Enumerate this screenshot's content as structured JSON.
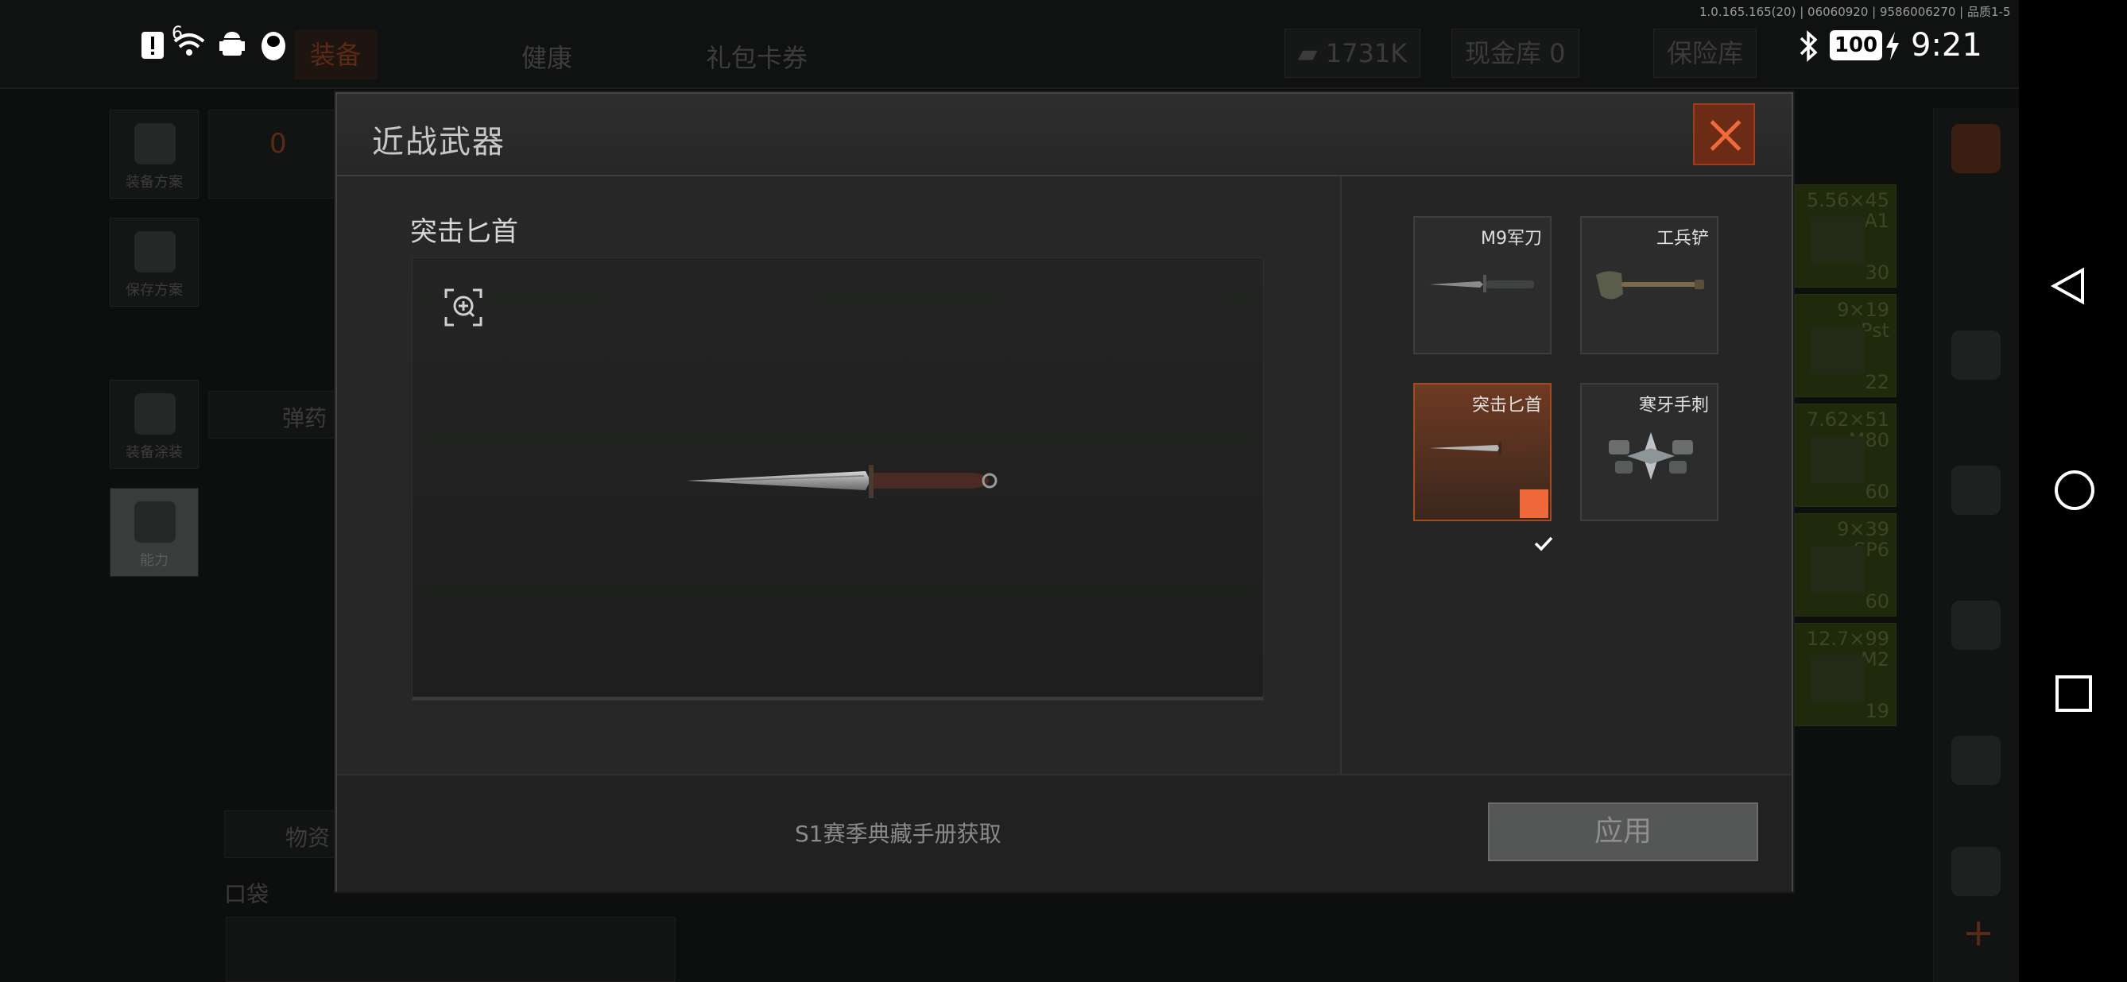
{
  "status_bar": {
    "time": "9:21",
    "battery": "100",
    "signal_sup": "6"
  },
  "build_info": "1.0.165.165(20) | 06060920 | 9586006270 | 品质1-5",
  "background": {
    "tabs": [
      {
        "label": "装备",
        "active": true
      },
      {
        "label": "健康",
        "active": false
      },
      {
        "label": "礼包卡券",
        "active": false
      }
    ],
    "currency": {
      "money": "1731K",
      "cash_vault": "现金库 0",
      "safe": "保险库"
    },
    "left_buttons": [
      "装备方案",
      "保存方案",
      "装备涂装",
      "能力"
    ],
    "backpack_count": "0",
    "panels": {
      "ammo": "弹药",
      "supplies": "物资",
      "pocket": "口袋"
    },
    "ammo": [
      {
        "caliber": "5.56×45",
        "type": "A1",
        "count": "30"
      },
      {
        "caliber": "9×19",
        "type": "Pst",
        "count": "22"
      },
      {
        "caliber": "7.62×51",
        "type": "M80",
        "count": "60"
      },
      {
        "caliber": "9×39",
        "type": "SP6",
        "count": "60"
      },
      {
        "caliber": "12.7×99",
        "type": "M2",
        "count": "19"
      }
    ]
  },
  "modal": {
    "title": "近战武器",
    "selected_item": "突击匕首",
    "source_text": "S1赛季典藏手册获取",
    "apply_label": "应用",
    "weapons": [
      {
        "label": "M9军刀",
        "selected": false
      },
      {
        "label": "工兵铲",
        "selected": false
      },
      {
        "label": "突击匕首",
        "selected": true
      },
      {
        "label": "寒牙手刺",
        "selected": false
      }
    ]
  },
  "colors": {
    "accent": "#f0693a",
    "selected_bg": "#6e3a22",
    "modal_bg": "#262726"
  }
}
